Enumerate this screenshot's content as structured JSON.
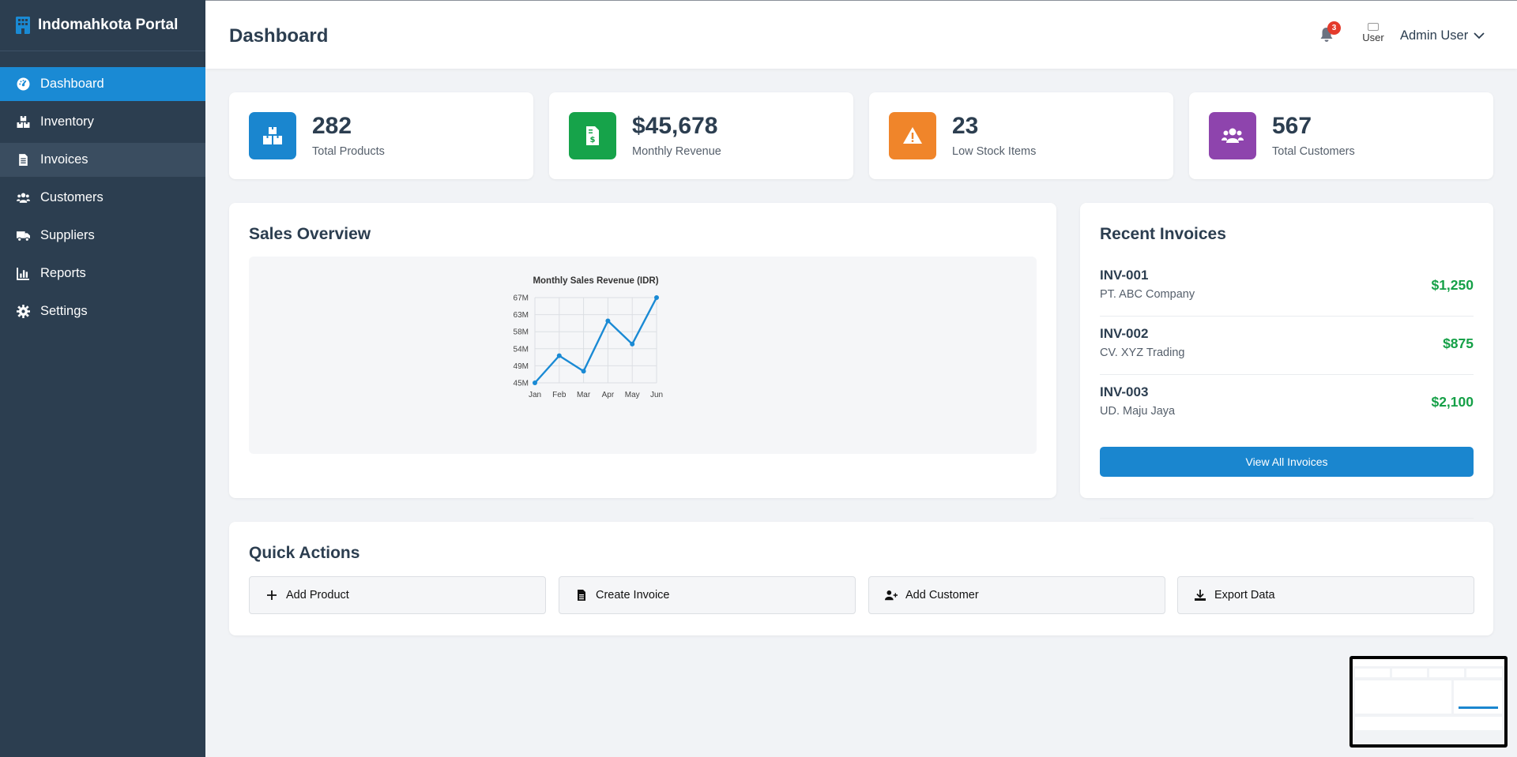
{
  "brand": {
    "name": "Indomahkota Portal",
    "icon": "building-icon"
  },
  "sidebar": {
    "items": [
      {
        "label": "Dashboard",
        "icon": "dashboard-icon",
        "state": "active"
      },
      {
        "label": "Inventory",
        "icon": "boxes-icon",
        "state": "normal"
      },
      {
        "label": "Invoices",
        "icon": "file-invoice-icon",
        "state": "hover"
      },
      {
        "label": "Customers",
        "icon": "users-icon",
        "state": "normal"
      },
      {
        "label": "Suppliers",
        "icon": "truck-icon",
        "state": "normal"
      },
      {
        "label": "Reports",
        "icon": "chart-bar-icon",
        "state": "normal"
      },
      {
        "label": "Settings",
        "icon": "gear-icon",
        "state": "normal"
      }
    ]
  },
  "header": {
    "title": "Dashboard",
    "notification_count": "3",
    "avatar_alt": "User",
    "user_name": "Admin User"
  },
  "stats": [
    {
      "value": "282",
      "label": "Total Products",
      "color": "#1a86cf",
      "icon": "boxes-icon"
    },
    {
      "value": "$45,678",
      "label": "Monthly Revenue",
      "color": "#16a34a",
      "icon": "invoice-dollar-icon"
    },
    {
      "value": "23",
      "label": "Low Stock Items",
      "color": "#f0852a",
      "icon": "warning-icon"
    },
    {
      "value": "567",
      "label": "Total Customers",
      "color": "#8e44ad",
      "icon": "users-icon"
    }
  ],
  "sales_overview": {
    "title": "Sales Overview",
    "chart_data": {
      "type": "line",
      "title": "Monthly Sales Revenue (IDR)",
      "categories": [
        "Jan",
        "Feb",
        "Mar",
        "Apr",
        "May",
        "Jun"
      ],
      "series": [
        {
          "values": [
            45000000,
            52000000,
            48000000,
            61000000,
            55000000,
            67000000
          ],
          "color": "#1a8ad4"
        }
      ],
      "y_ticks": [
        "45M",
        "49M",
        "54M",
        "58M",
        "63M",
        "67M"
      ],
      "ylim": [
        45000000,
        67000000
      ],
      "grid": true
    }
  },
  "recent_invoices": {
    "title": "Recent Invoices",
    "items": [
      {
        "id": "INV-001",
        "company": "PT. ABC Company",
        "amount": "$1,250"
      },
      {
        "id": "INV-002",
        "company": "CV. XYZ Trading",
        "amount": "$875"
      },
      {
        "id": "INV-003",
        "company": "UD. Maju Jaya",
        "amount": "$2,100"
      }
    ],
    "view_all_label": "View All Invoices"
  },
  "quick_actions": {
    "title": "Quick Actions",
    "items": [
      {
        "label": "Add Product",
        "icon": "plus-icon"
      },
      {
        "label": "Create Invoice",
        "icon": "file-icon"
      },
      {
        "label": "Add Customer",
        "icon": "user-plus-icon"
      },
      {
        "label": "Export Data",
        "icon": "download-icon"
      }
    ]
  }
}
